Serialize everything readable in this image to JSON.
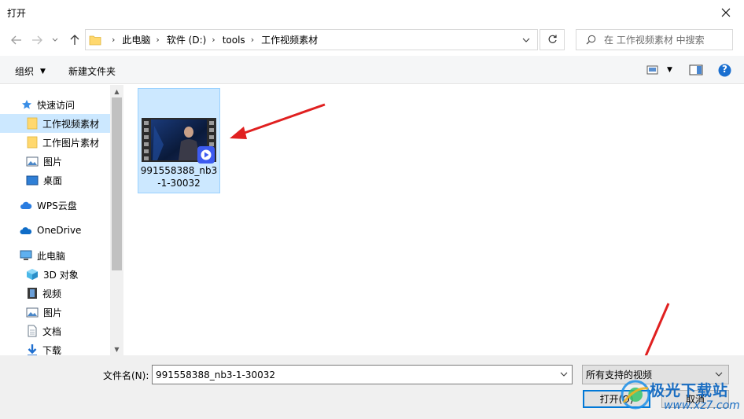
{
  "window": {
    "title": "打开"
  },
  "nav": {
    "breadcrumbs": [
      "此电脑",
      "软件 (D:)",
      "tools",
      "工作视频素材"
    ],
    "search_placeholder": "在 工作视频素材 中搜索"
  },
  "toolbar": {
    "organize": "组织",
    "new_folder": "新建文件夹",
    "help": "?"
  },
  "sidebar": {
    "items": [
      {
        "label": "快速访问",
        "icon": "star-icon"
      },
      {
        "label": "工作视频素材",
        "icon": "folder-icon"
      },
      {
        "label": "工作图片素材",
        "icon": "folder-icon"
      },
      {
        "label": "图片",
        "icon": "pictures-icon"
      },
      {
        "label": "桌面",
        "icon": "desktop-icon"
      },
      {
        "label": "WPS云盘",
        "icon": "cloud-icon"
      },
      {
        "label": "OneDrive",
        "icon": "onedrive-icon"
      },
      {
        "label": "此电脑",
        "icon": "computer-icon"
      },
      {
        "label": "3D 对象",
        "icon": "cube-icon"
      },
      {
        "label": "视频",
        "icon": "video-icon"
      },
      {
        "label": "图片",
        "icon": "pictures-icon"
      },
      {
        "label": "文档",
        "icon": "document-icon"
      },
      {
        "label": "下载",
        "icon": "download-icon"
      }
    ]
  },
  "files": [
    {
      "name_line1": "991558388_nb3",
      "name_line2": "-1-30032"
    }
  ],
  "footer": {
    "filename_label": "文件名(N):",
    "filename_value": "991558388_nb3-1-30032",
    "filetype": "所有支持的视频",
    "open_button": "打开(O)",
    "cancel_button": "取消"
  },
  "watermark": {
    "text1": "极光下载站",
    "text2": "www.xz7.com"
  },
  "colors": {
    "selection": "#cce8ff",
    "accent": "#0078d7",
    "arrow": "#e02020"
  }
}
